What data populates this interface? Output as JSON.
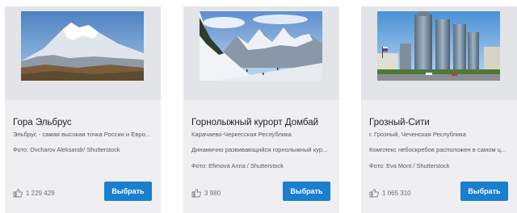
{
  "cards": [
    {
      "title": "Гора Эльбрус",
      "subtitle": "Эльбрус - самая высокая точка России и Евро...",
      "description": "",
      "credit": "Фото: Ovcharov Aleksandr/ Shutterstock",
      "likes": "1 229 429",
      "button_label": "Выбрать",
      "image": "snow-capped-twin-peak-mountain"
    },
    {
      "title": "Горнолыжный курорт Домбай",
      "subtitle": "Карачаево-Черкесская Республика",
      "description": "Динамично развивающийся горнолыжный кур...",
      "credit": "Фото: Efimova Anna / Shutterstock",
      "likes": "3 980",
      "button_label": "Выбрать",
      "image": "snowy-ski-slope-mountains"
    },
    {
      "title": "Грозный-Сити",
      "subtitle": "г. Грозный, Чеченская Республика",
      "description": "Комплекс небоскребов расположен в самом ц...",
      "credit": "Фото: Eva Mont / Shutterstock",
      "likes": "1 065 310",
      "button_label": "Выбрать",
      "image": "skyscrapers-city"
    }
  ],
  "colors": {
    "button": "#1a7fce",
    "card_bg": "#efeff1",
    "photo_bg": "#e3e4e7"
  }
}
